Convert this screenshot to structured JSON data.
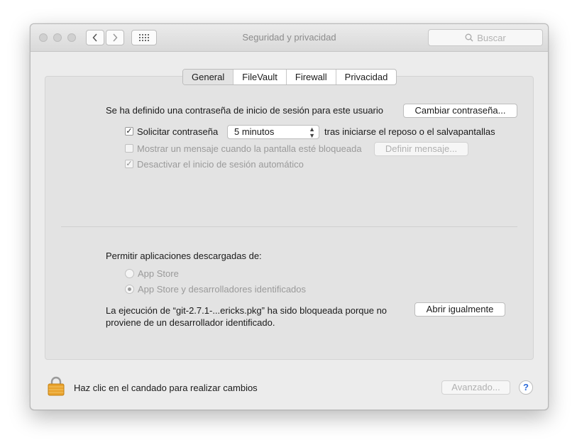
{
  "window": {
    "title": "Seguridad y privacidad",
    "search_placeholder": "Buscar"
  },
  "tabs": [
    {
      "label": "General",
      "selected": true
    },
    {
      "label": "FileVault",
      "selected": false
    },
    {
      "label": "Firewall",
      "selected": false
    },
    {
      "label": "Privacidad",
      "selected": false
    }
  ],
  "general": {
    "password_set_text": "Se ha definido una contraseña de inicio de sesión para este usuario",
    "change_password_button": "Cambiar contraseña...",
    "require_password": {
      "label": "Solicitar contraseña",
      "checked": true
    },
    "require_password_delay": "5 minutos",
    "require_password_suffix": "tras iniciarse el reposo o el salvapantallas",
    "show_message": {
      "label": "Mostrar un mensaje cuando la pantalla esté bloqueada",
      "checked": false,
      "enabled": false
    },
    "set_message_button": "Definir mensaje...",
    "disable_auto_login": {
      "label": "Desactivar el inicio de sesión automático",
      "checked": true,
      "enabled": false
    }
  },
  "downloads": {
    "heading": "Permitir aplicaciones descargadas de:",
    "options": [
      {
        "label": "App Store",
        "selected": false
      },
      {
        "label": "App Store y desarrolladores identificados",
        "selected": true
      }
    ],
    "blocked_line1": "La ejecución de “git-2.7.1-...ericks.pkg” ha sido bloqueada porque no",
    "blocked_line2": "proviene de un desarrollador identificado.",
    "open_anyway_button": "Abrir igualmente"
  },
  "footer": {
    "lock_text": "Haz clic en el candado para realizar cambios",
    "advanced_button": "Avanzado...",
    "help_label": "?"
  },
  "colors": {
    "lock": "#e9a32e",
    "help_accent": "#2d6bd9"
  }
}
